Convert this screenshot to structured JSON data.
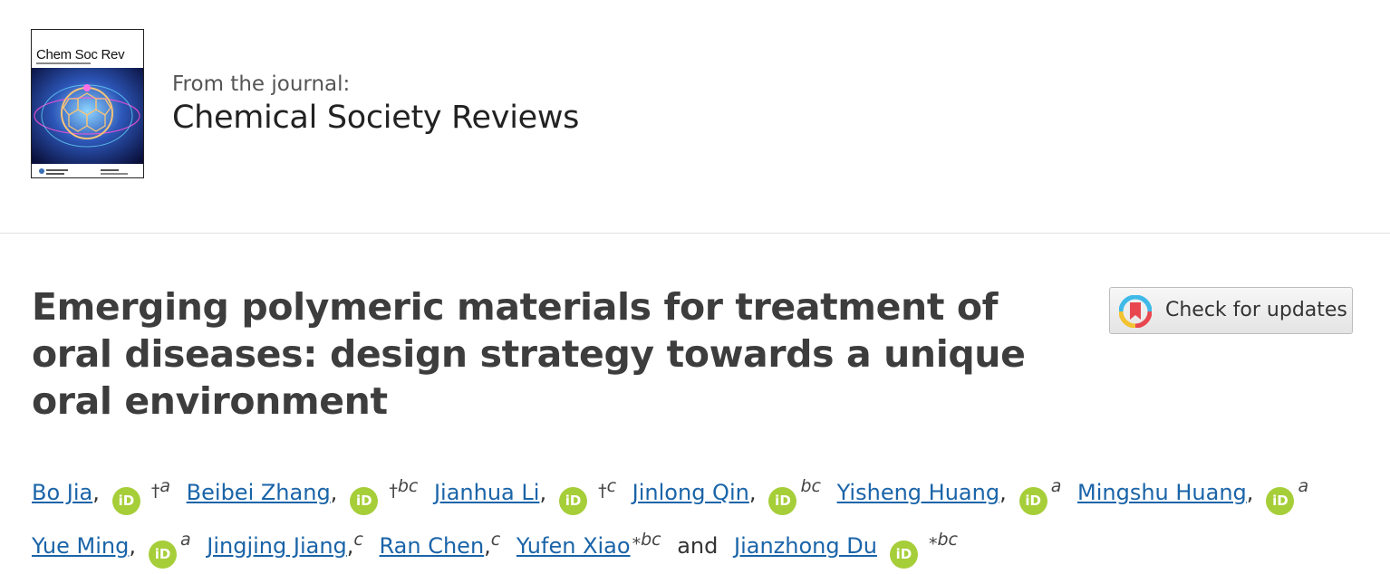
{
  "journal": {
    "cover_title": "Chem Soc Rev",
    "from_label": "From the journal:",
    "name": "Chemical Society Reviews"
  },
  "article": {
    "title": "Emerging polymeric materials for treatment of oral diseases: design strategy towards a unique oral environment"
  },
  "check_updates": {
    "label": "Check for updates"
  },
  "orcid_label": "iD",
  "authors": {
    "a1": {
      "name": "Bo Jia",
      "mark": "†",
      "aff": "a"
    },
    "a2": {
      "name": "Beibei Zhang",
      "mark": "†",
      "aff": "bc"
    },
    "a3": {
      "name": "Jianhua Li",
      "mark": "†",
      "aff": "c"
    },
    "a4": {
      "name": "Jinlong Qin",
      "aff": "bc"
    },
    "a5": {
      "name": "Yisheng Huang",
      "aff": "a"
    },
    "a6": {
      "name": "Mingshu Huang",
      "aff": "a"
    },
    "a7": {
      "name": "Yue Ming",
      "aff": "a"
    },
    "a8": {
      "name": "Jingjing Jiang",
      "aff": "c"
    },
    "a9": {
      "name": "Ran Chen",
      "aff": "c"
    },
    "a10": {
      "name": "Yufen Xiao",
      "mark": "*",
      "aff": "bc"
    },
    "a11": {
      "name": "Jianzhong Du",
      "mark": "*",
      "aff": "bc"
    },
    "comma": ",",
    "and": "and"
  },
  "colors": {
    "link": "#1a64a8",
    "orcid": "#a6ce39",
    "title": "#3d3d3d"
  }
}
